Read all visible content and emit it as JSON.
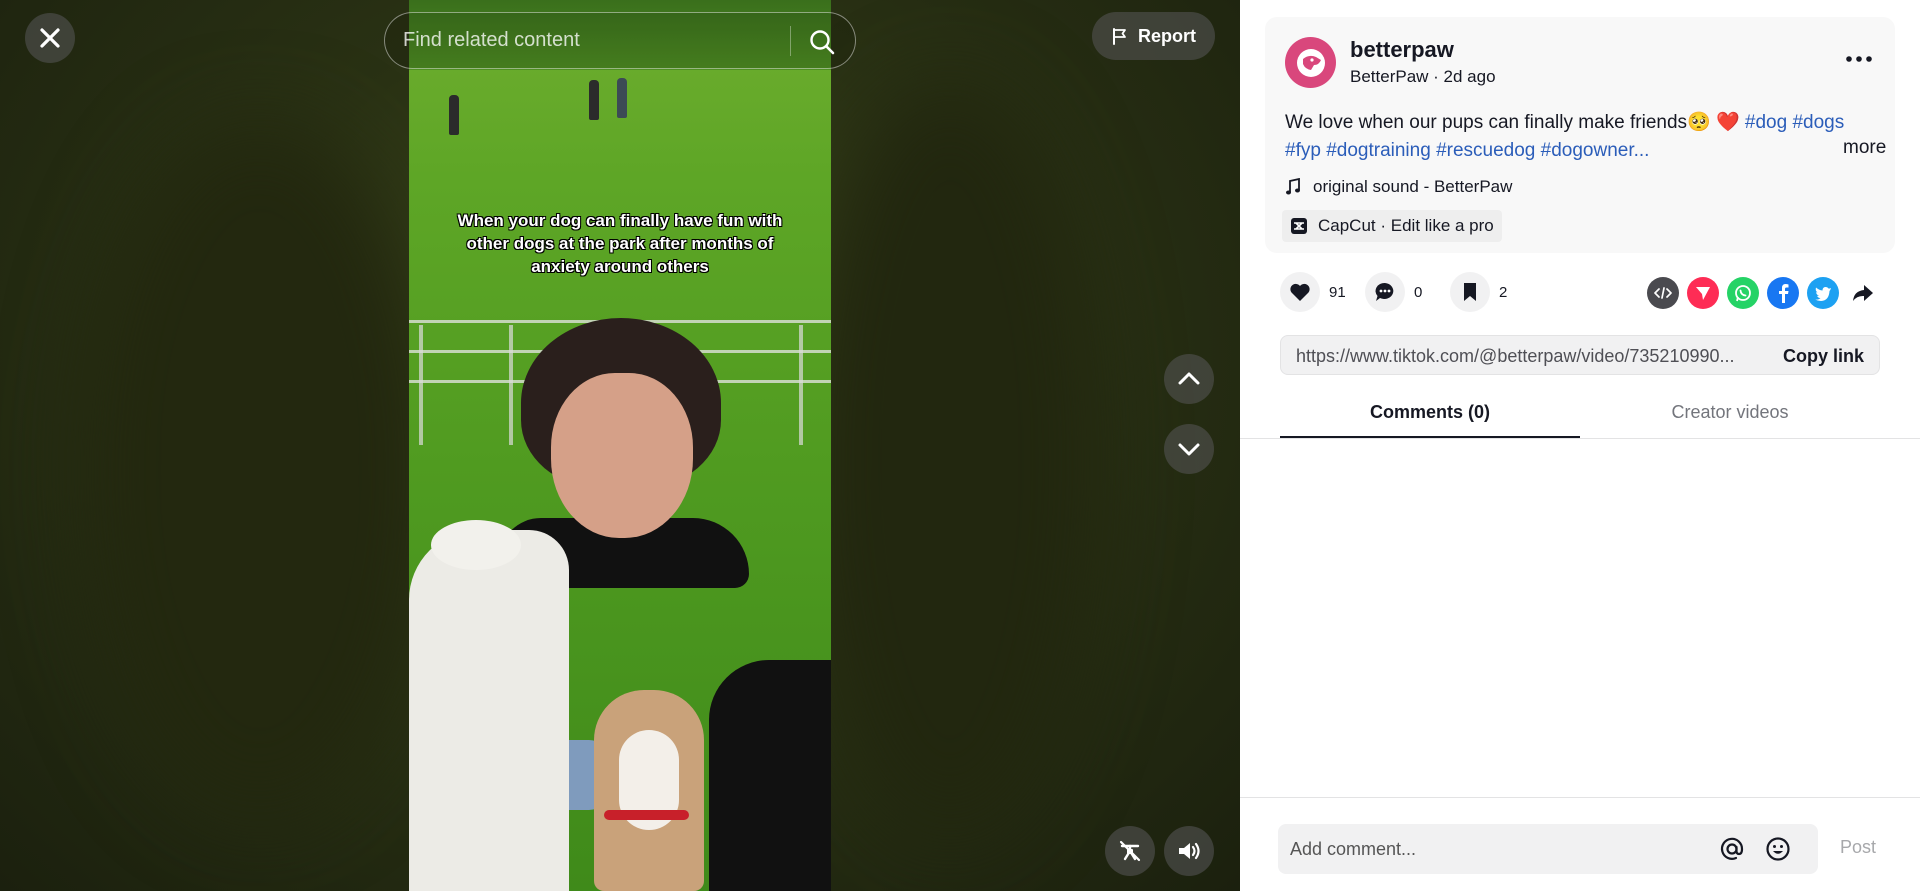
{
  "player": {
    "search_placeholder": "Find related content",
    "report_label": "Report",
    "caption": "When your dog can finally have fun with other dogs at the park after months of anxiety around others"
  },
  "author": {
    "username": "betterpaw",
    "display_name": "BetterPaw",
    "posted": "2d ago",
    "meta_sep": " · "
  },
  "post": {
    "text": "We love when our pups can finally make friends🥺 ❤️ ",
    "hashtags": [
      "#dog",
      "#dogs",
      "#fyp",
      "#dogtraining",
      "#rescuedog",
      "#dogowner..."
    ],
    "more_label": "more",
    "sound": "original sound - BetterPaw",
    "capcut": "CapCut · Edit like a pro"
  },
  "stats": {
    "likes": "91",
    "comments": "0",
    "saves": "2"
  },
  "share": {
    "icons": [
      "embed-icon",
      "send-icon",
      "whatsapp-icon",
      "facebook-icon",
      "twitter-icon",
      "share-arrow-icon"
    ],
    "colors": {
      "embed": "#4a4a4f",
      "send": "#fe2c55",
      "whatsapp": "#25d366",
      "facebook": "#1877f2",
      "twitter": "#1da1f2"
    }
  },
  "link": {
    "url": "https://www.tiktok.com/@betterpaw/video/735210990...",
    "copy_label": "Copy link"
  },
  "tabs": [
    {
      "label": "Comments (0)",
      "active": true
    },
    {
      "label": "Creator videos",
      "active": false
    }
  ],
  "comment": {
    "placeholder": "Add comment...",
    "post_label": "Post"
  },
  "colors": {
    "accent": "#fe2c55",
    "hashtag": "#2b5db9",
    "avatar": "#d9477c"
  }
}
